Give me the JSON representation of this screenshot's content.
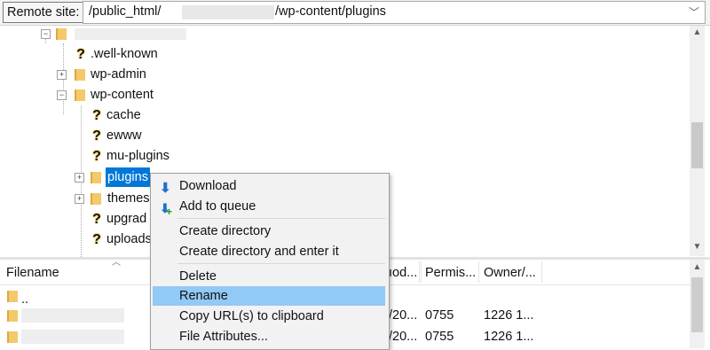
{
  "remote_site": {
    "label": "Remote site:",
    "path_prefix": "/public_html/",
    "path_suffix": "/wp-content/plugins"
  },
  "tree": {
    "items": [
      {
        "label": ".well-known",
        "icon": "unknown-folder-icon"
      },
      {
        "label": "wp-admin",
        "icon": "folder-icon"
      },
      {
        "label": "wp-content",
        "icon": "folder-icon"
      },
      {
        "label": "cache",
        "icon": "unknown-folder-icon"
      },
      {
        "label": "ewww",
        "icon": "unknown-folder-icon"
      },
      {
        "label": "mu-plugins",
        "icon": "unknown-folder-icon"
      },
      {
        "label": "plugins",
        "icon": "folder-icon"
      },
      {
        "label": "themes",
        "icon": "folder-icon"
      },
      {
        "label": "upgrad",
        "icon": "unknown-folder-icon"
      },
      {
        "label": "uploads",
        "icon": "unknown-folder-icon"
      }
    ],
    "expander_plus": "+",
    "expander_minus": "−"
  },
  "filelist": {
    "columns": {
      "filename": "Filename",
      "modified": "ıod...",
      "permissions": "Permis...",
      "owner": "Owner/..."
    },
    "rows": [
      {
        "name": "..",
        "modified": "",
        "permissions": "",
        "owner": ""
      },
      {
        "name": "",
        "modified": "/20...",
        "permissions": "0755",
        "owner": "1226 1..."
      },
      {
        "name": "",
        "modified": "/20...",
        "permissions": "0755",
        "owner": "1226 1..."
      }
    ]
  },
  "context_menu": {
    "download": "Download",
    "add_to_queue": "Add to queue",
    "create_directory": "Create directory",
    "create_directory_enter": "Create directory and enter it",
    "delete": "Delete",
    "rename": "Rename",
    "copy_urls": "Copy URL(s) to clipboard",
    "file_attributes": "File Attributes..."
  },
  "colors": {
    "selection": "#0078d7",
    "menu_highlight": "#91c9f7",
    "folder": "#f4c96b"
  }
}
